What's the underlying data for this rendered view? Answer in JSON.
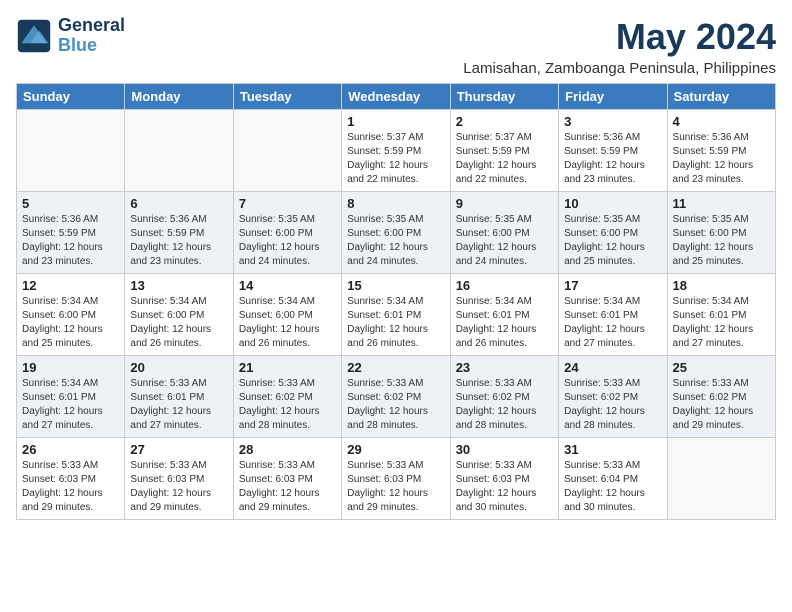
{
  "header": {
    "logo_line1": "General",
    "logo_line2": "Blue",
    "month_title": "May 2024",
    "location": "Lamisahan, Zamboanga Peninsula, Philippines"
  },
  "days_of_week": [
    "Sunday",
    "Monday",
    "Tuesday",
    "Wednesday",
    "Thursday",
    "Friday",
    "Saturday"
  ],
  "weeks": [
    [
      {
        "day": "",
        "info": ""
      },
      {
        "day": "",
        "info": ""
      },
      {
        "day": "",
        "info": ""
      },
      {
        "day": "1",
        "info": "Sunrise: 5:37 AM\nSunset: 5:59 PM\nDaylight: 12 hours\nand 22 minutes."
      },
      {
        "day": "2",
        "info": "Sunrise: 5:37 AM\nSunset: 5:59 PM\nDaylight: 12 hours\nand 22 minutes."
      },
      {
        "day": "3",
        "info": "Sunrise: 5:36 AM\nSunset: 5:59 PM\nDaylight: 12 hours\nand 23 minutes."
      },
      {
        "day": "4",
        "info": "Sunrise: 5:36 AM\nSunset: 5:59 PM\nDaylight: 12 hours\nand 23 minutes."
      }
    ],
    [
      {
        "day": "5",
        "info": "Sunrise: 5:36 AM\nSunset: 5:59 PM\nDaylight: 12 hours\nand 23 minutes."
      },
      {
        "day": "6",
        "info": "Sunrise: 5:36 AM\nSunset: 5:59 PM\nDaylight: 12 hours\nand 23 minutes."
      },
      {
        "day": "7",
        "info": "Sunrise: 5:35 AM\nSunset: 6:00 PM\nDaylight: 12 hours\nand 24 minutes."
      },
      {
        "day": "8",
        "info": "Sunrise: 5:35 AM\nSunset: 6:00 PM\nDaylight: 12 hours\nand 24 minutes."
      },
      {
        "day": "9",
        "info": "Sunrise: 5:35 AM\nSunset: 6:00 PM\nDaylight: 12 hours\nand 24 minutes."
      },
      {
        "day": "10",
        "info": "Sunrise: 5:35 AM\nSunset: 6:00 PM\nDaylight: 12 hours\nand 25 minutes."
      },
      {
        "day": "11",
        "info": "Sunrise: 5:35 AM\nSunset: 6:00 PM\nDaylight: 12 hours\nand 25 minutes."
      }
    ],
    [
      {
        "day": "12",
        "info": "Sunrise: 5:34 AM\nSunset: 6:00 PM\nDaylight: 12 hours\nand 25 minutes."
      },
      {
        "day": "13",
        "info": "Sunrise: 5:34 AM\nSunset: 6:00 PM\nDaylight: 12 hours\nand 26 minutes."
      },
      {
        "day": "14",
        "info": "Sunrise: 5:34 AM\nSunset: 6:00 PM\nDaylight: 12 hours\nand 26 minutes."
      },
      {
        "day": "15",
        "info": "Sunrise: 5:34 AM\nSunset: 6:01 PM\nDaylight: 12 hours\nand 26 minutes."
      },
      {
        "day": "16",
        "info": "Sunrise: 5:34 AM\nSunset: 6:01 PM\nDaylight: 12 hours\nand 26 minutes."
      },
      {
        "day": "17",
        "info": "Sunrise: 5:34 AM\nSunset: 6:01 PM\nDaylight: 12 hours\nand 27 minutes."
      },
      {
        "day": "18",
        "info": "Sunrise: 5:34 AM\nSunset: 6:01 PM\nDaylight: 12 hours\nand 27 minutes."
      }
    ],
    [
      {
        "day": "19",
        "info": "Sunrise: 5:34 AM\nSunset: 6:01 PM\nDaylight: 12 hours\nand 27 minutes."
      },
      {
        "day": "20",
        "info": "Sunrise: 5:33 AM\nSunset: 6:01 PM\nDaylight: 12 hours\nand 27 minutes."
      },
      {
        "day": "21",
        "info": "Sunrise: 5:33 AM\nSunset: 6:02 PM\nDaylight: 12 hours\nand 28 minutes."
      },
      {
        "day": "22",
        "info": "Sunrise: 5:33 AM\nSunset: 6:02 PM\nDaylight: 12 hours\nand 28 minutes."
      },
      {
        "day": "23",
        "info": "Sunrise: 5:33 AM\nSunset: 6:02 PM\nDaylight: 12 hours\nand 28 minutes."
      },
      {
        "day": "24",
        "info": "Sunrise: 5:33 AM\nSunset: 6:02 PM\nDaylight: 12 hours\nand 28 minutes."
      },
      {
        "day": "25",
        "info": "Sunrise: 5:33 AM\nSunset: 6:02 PM\nDaylight: 12 hours\nand 29 minutes."
      }
    ],
    [
      {
        "day": "26",
        "info": "Sunrise: 5:33 AM\nSunset: 6:03 PM\nDaylight: 12 hours\nand 29 minutes."
      },
      {
        "day": "27",
        "info": "Sunrise: 5:33 AM\nSunset: 6:03 PM\nDaylight: 12 hours\nand 29 minutes."
      },
      {
        "day": "28",
        "info": "Sunrise: 5:33 AM\nSunset: 6:03 PM\nDaylight: 12 hours\nand 29 minutes."
      },
      {
        "day": "29",
        "info": "Sunrise: 5:33 AM\nSunset: 6:03 PM\nDaylight: 12 hours\nand 29 minutes."
      },
      {
        "day": "30",
        "info": "Sunrise: 5:33 AM\nSunset: 6:03 PM\nDaylight: 12 hours\nand 30 minutes."
      },
      {
        "day": "31",
        "info": "Sunrise: 5:33 AM\nSunset: 6:04 PM\nDaylight: 12 hours\nand 30 minutes."
      },
      {
        "day": "",
        "info": ""
      }
    ]
  ]
}
